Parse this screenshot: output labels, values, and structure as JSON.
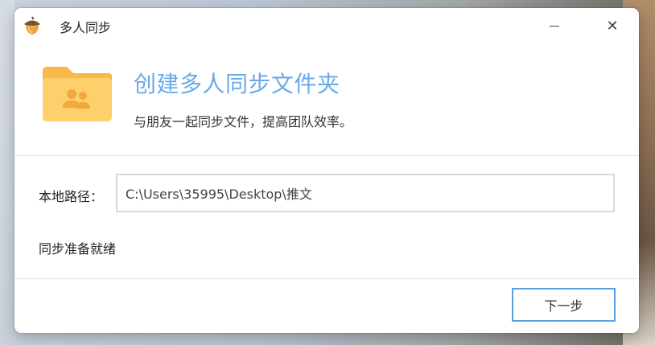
{
  "window": {
    "title": "多人同步",
    "minimize_label": "",
    "close_label": "✕"
  },
  "header": {
    "heading": "创建多人同步文件夹",
    "subheading": "与朋友一起同步文件，提高团队效率。"
  },
  "form": {
    "path_label": "本地路径：",
    "path_value": "C:\\Users\\35995\\Desktop\\推文"
  },
  "status": {
    "text": "同步准备就绪"
  },
  "footer": {
    "next_label": "下一步"
  },
  "colors": {
    "accent": "#6aa9e9",
    "button_border": "#5b9fe3",
    "folder": "#fdd06b"
  },
  "icons": {
    "app": "acorn-icon",
    "folder": "shared-folder-icon"
  }
}
